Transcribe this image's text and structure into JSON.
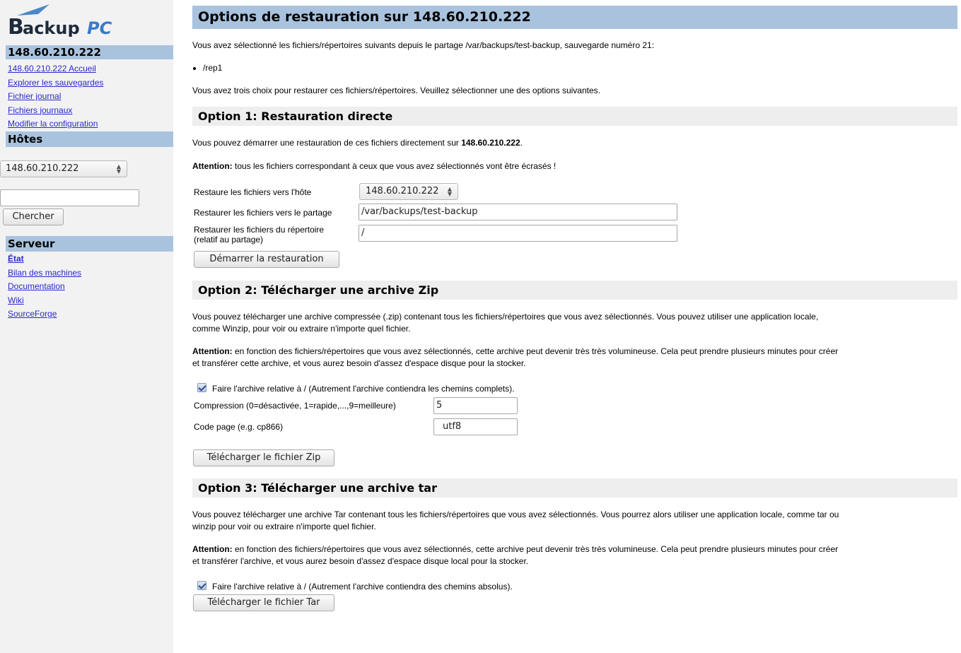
{
  "sidebar": {
    "logo": {
      "letter": "B",
      "text": "ackup",
      "accent": "PC"
    },
    "host_header": "148.60.210.222",
    "host_links": [
      "148.60.210.222 Accueil",
      "Explorer les sauvegardes",
      "Fichier journal",
      "Fichiers journaux",
      "Modifier la configuration"
    ],
    "hosts_header": "Hôtes",
    "host_select": "148.60.210.222",
    "search_value": "",
    "search_button": "Chercher",
    "server_header": "Serveur",
    "server_links": [
      "État",
      "Bilan des machines",
      "Documentation",
      "Wiki",
      "SourceForge"
    ]
  },
  "main": {
    "title": "Options de restauration sur 148.60.210.222",
    "intro": "Vous avez sélectionné les fichiers/répertoires suivants depuis le partage /var/backups/test-backup, sauvegarde numéro 21:",
    "files": [
      "/rep1"
    ],
    "choices": "Vous avez trois choix pour restaurer ces fichiers/répertoires. Veuillez sélectionner une des options suivantes.",
    "option1": {
      "title": "Option 1: Restauration directe",
      "desc_prefix": "Vous pouvez démarrer une restauration de ces fichiers directement sur ",
      "desc_host": "148.60.210.222",
      "desc_suffix": ".",
      "warn_label": "Attention:",
      "warn_text": " tous les fichiers correspondant à ceux que vous avez sélectionnés vont être écrasés !",
      "host_label": "Restaure les fichiers vers l'hôte",
      "host_value": "148.60.210.222",
      "share_label": "Restaurer les fichiers vers le partage",
      "share_value": "/var/backups/test-backup",
      "dir_label_1": "Restaurer les fichiers du répertoire",
      "dir_label_2": "(relatif au partage)",
      "dir_value": "/",
      "button": "Démarrer la restauration"
    },
    "option2": {
      "title": "Option 2: Télécharger une archive Zip",
      "desc_1": "Vous pouvez télécharger une archive compressée (.zip) contenant tous les fichiers/répertoires que vous avez sélectionnés. Vous pouvez utiliser une application locale,",
      "desc_2": "comme Winzip, pour voir ou extraire n'importe quel fichier.",
      "warn_label": "Attention:",
      "warn_1": " en fonction des fichiers/répertoires que vous avez sélectionnés, cette archive peut devenir très très volumineuse. Cela peut prendre plusieurs minutes pour créer",
      "warn_2": "et transférer cette archive, et vous aurez besoin d'assez d'espace disque pour la stocker.",
      "relative_label": "Faire l'archive relative à / (Autrement l'archive contiendra les chemins complets).",
      "relative_checked": true,
      "compression_label": "Compression (0=désactivée, 1=rapide,...,9=meilleure)",
      "compression_value": "5",
      "codepage_label": "Code page (e.g. cp866)",
      "codepage_value": "utf8",
      "button": "Télécharger le fichier Zip"
    },
    "option3": {
      "title": "Option 3: Télécharger une archive tar",
      "desc_1": "Vous pouvez télécharger une archive Tar contenant tous les fichiers/répertoires que vous avez sélectionnés. Vous pourrez alors utiliser une application locale, comme tar ou",
      "desc_2": "winzip pour voir ou extraire n'importe quel fichier.",
      "warn_label": "Attention:",
      "warn_1": " en fonction des fichiers/répertoires que vous avez sélectionnés, cette archive peut devenir très très volumineuse. Cela peut prendre plusieurs minutes pour créer",
      "warn_2": "et transférer l'archive, et vous aurez besoin d'assez d'espace disque local pour la stocker.",
      "relative_label": "Faire l'archive relative à / (Autrement l'archive contiendra des chemins absolus).",
      "relative_checked": true,
      "button": "Télécharger le fichier Tar"
    }
  },
  "colors": {
    "header_blue": "#a9c3df",
    "link_blue": "#2a2ac8",
    "option_gray": "#eeeeee",
    "logo_dark": "#1e2a3c",
    "logo_accent": "#3a7ac8"
  }
}
